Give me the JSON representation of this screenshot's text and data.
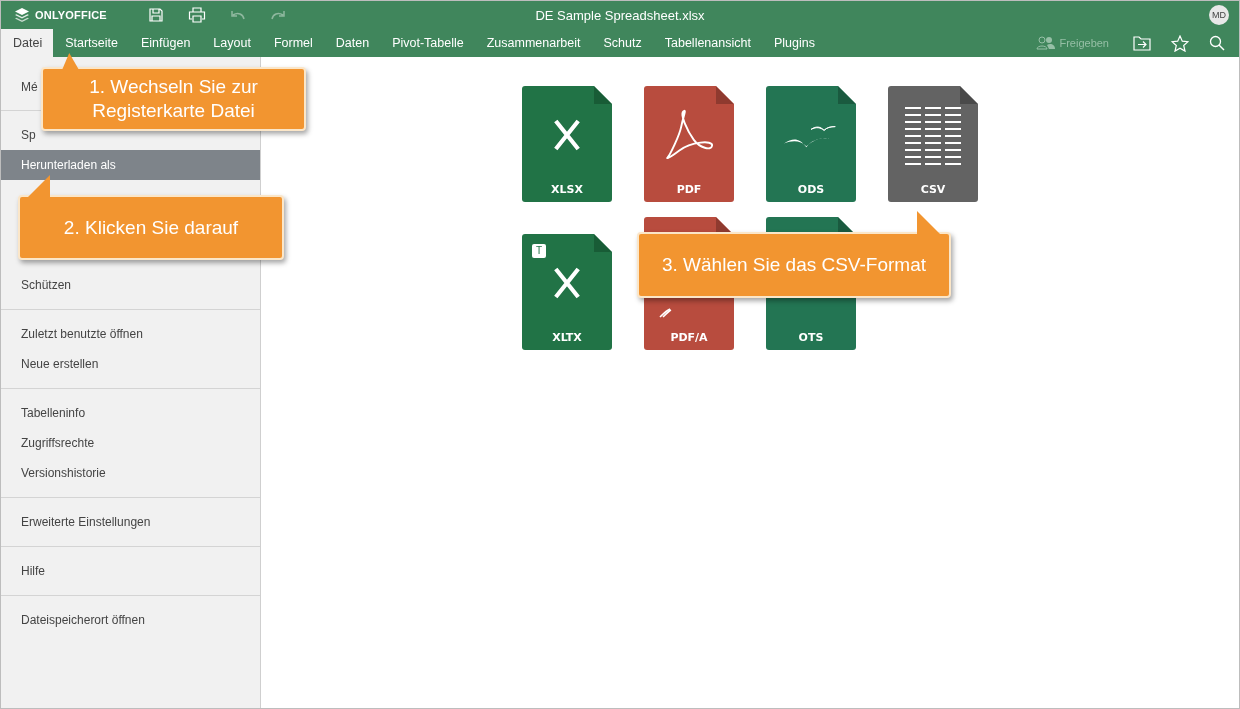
{
  "header": {
    "brand": "ONLYOFFICE",
    "title": "DE Sample Spreadsheet.xlsx",
    "avatar": "MD"
  },
  "tabs": [
    {
      "label": "Datei",
      "selected": true
    },
    {
      "label": "Startseite",
      "selected": false
    },
    {
      "label": "Einfügen",
      "selected": false
    },
    {
      "label": "Layout",
      "selected": false
    },
    {
      "label": "Formel",
      "selected": false
    },
    {
      "label": "Daten",
      "selected": false
    },
    {
      "label": "Pivot-Tabelle",
      "selected": false
    },
    {
      "label": "Zusammenarbeit",
      "selected": false
    },
    {
      "label": "Schutz",
      "selected": false
    },
    {
      "label": "Tabellenansicht",
      "selected": false
    },
    {
      "label": "Plugins",
      "selected": false
    }
  ],
  "share": {
    "label": "Freigeben",
    "disabled": true
  },
  "sidebar": {
    "groups": [
      [
        {
          "label": "Mé",
          "selected": false
        }
      ],
      [
        {
          "label": "Sp",
          "selected": false
        },
        {
          "label": "Herunterladen als",
          "selected": true
        },
        {
          "label": "Schützen",
          "selected": false
        }
      ],
      [
        {
          "label": "Zuletzt benutzte öffnen",
          "selected": false
        },
        {
          "label": "Neue erstellen",
          "selected": false
        }
      ],
      [
        {
          "label": "Tabelleninfo",
          "selected": false
        },
        {
          "label": "Zugriffsrechte",
          "selected": false
        },
        {
          "label": "Versionshistorie",
          "selected": false
        }
      ],
      [
        {
          "label": "Erweiterte Einstellungen",
          "selected": false
        }
      ],
      [
        {
          "label": "Hilfe",
          "selected": false
        }
      ],
      [
        {
          "label": "Dateispeicherort öffnen",
          "selected": false
        }
      ]
    ]
  },
  "formats": [
    [
      {
        "kind": "spreadsheet",
        "label": "XLSX"
      },
      {
        "kind": "pdf",
        "label": "PDF"
      },
      {
        "kind": "ods",
        "label": "ODS"
      },
      {
        "kind": "csv",
        "label": "CSV"
      }
    ],
    [
      {
        "kind": "spreadsheet",
        "label": "XLTX",
        "badge": "T"
      },
      {
        "kind": "pdf",
        "label": "PDF/A"
      },
      {
        "kind": "ods",
        "label": "OTS"
      }
    ]
  ],
  "callouts": [
    {
      "text": "1. Wechseln Sie zur Registerkarte Datei"
    },
    {
      "text": "2. Klicken Sie darauf"
    },
    {
      "text": "3. Wählen Sie das CSV-Format"
    }
  ]
}
